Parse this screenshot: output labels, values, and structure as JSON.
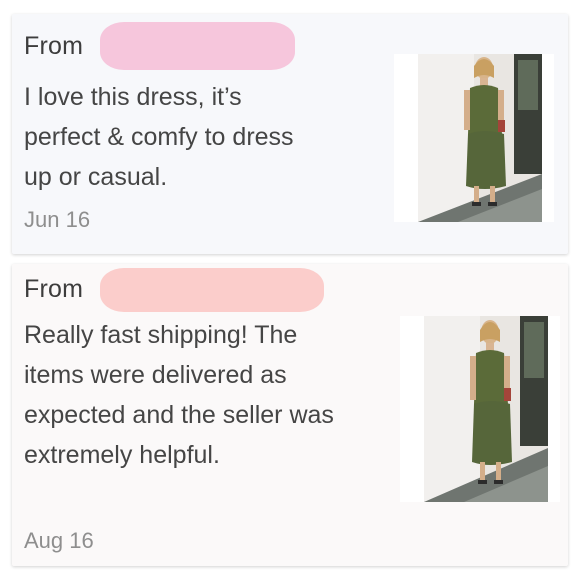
{
  "reviews": [
    {
      "from_label": "From",
      "text": "I love this dress, it’s perfect & comfy to dress up or casual.",
      "date": "Jun 16",
      "redaction_color": "#f6c6dc",
      "photo_icon": "olive-dress-photo"
    },
    {
      "from_label": "From",
      "text": "Really fast shipping! The items were delivered as expected and the seller was extremely helpful.",
      "date": "Aug 16",
      "redaction_color": "#fbcdcb",
      "photo_icon": "olive-dress-photo"
    }
  ]
}
